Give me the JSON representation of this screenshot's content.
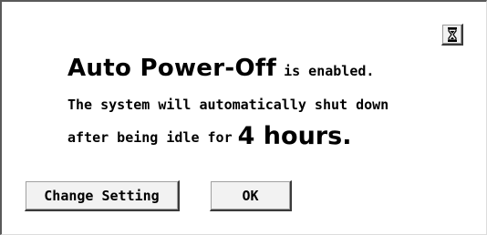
{
  "dialog": {
    "corner_icon": "hourglass-icon",
    "line1_big": "Auto Power-Off",
    "line1_small": "is enabled.",
    "line2": "The system will automatically shut down",
    "line3_text": "after being idle for",
    "line3_hours": "4 hours."
  },
  "buttons": {
    "change_setting": "Change Setting",
    "ok": "OK"
  }
}
